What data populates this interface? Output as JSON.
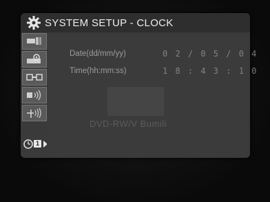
{
  "header": {
    "title": "SYSTEM SETUP - CLOCK",
    "icon": "gear-icon"
  },
  "sidebar": {
    "items": [
      {
        "icon": "video-setup-icon"
      },
      {
        "icon": "audio-setup-icon"
      },
      {
        "icon": "connection-icon"
      },
      {
        "icon": "speaker-icon"
      },
      {
        "icon": "antenna-icon"
      },
      {
        "icon": "clock-icon",
        "badge": "1",
        "active": true
      }
    ]
  },
  "clock": {
    "date_label": "Date(dd/mm/yy)",
    "date_value": "0 2 / 0 5 / 0 4",
    "time_label": "Time(hh:mm:ss)",
    "time_value": "1 8 : 4 3 : 1 0"
  },
  "background_text": "DVD-RW/V Bumili"
}
